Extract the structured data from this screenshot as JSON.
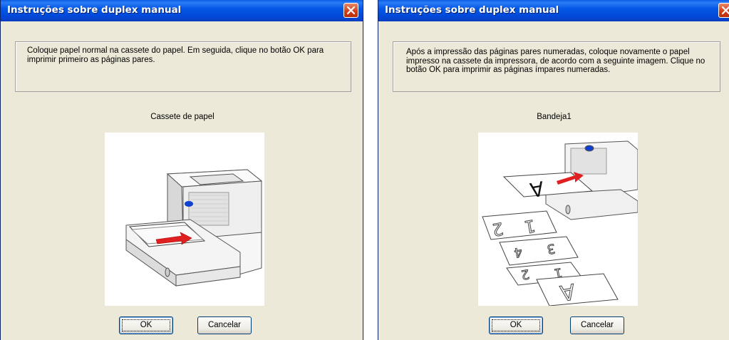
{
  "dialog1": {
    "title": "Instruções sobre duplex manual",
    "message": "Coloque papel normal na cassete do papel. Em seguida, clique no botão OK para imprimir primeiro as páginas pares.",
    "caption": "Cassete de papel",
    "ok_label": "OK",
    "cancel_label": "Cancelar"
  },
  "dialog2": {
    "title": "Instruções sobre duplex manual",
    "message": "Após a impressão das páginas pares numeradas, coloque novamente o papel impresso na cassete da impressora, de acordo com a seguinte imagem. Clique no botão OK para imprimir as páginas ímpares numeradas.",
    "caption": "Bandeja1",
    "ok_label": "OK",
    "cancel_label": "Cancelar",
    "illustration": {
      "sheet_letter": "A",
      "page_numbers": [
        "1",
        "2",
        "3",
        "4",
        "1",
        "2"
      ],
      "bottom_letter": "A"
    }
  },
  "colors": {
    "titlebar": "#0047d6",
    "dialog_bg": "#ece9d8",
    "close_button": "#d23a13",
    "arrow": "#e02020",
    "led": "#1040d0"
  }
}
